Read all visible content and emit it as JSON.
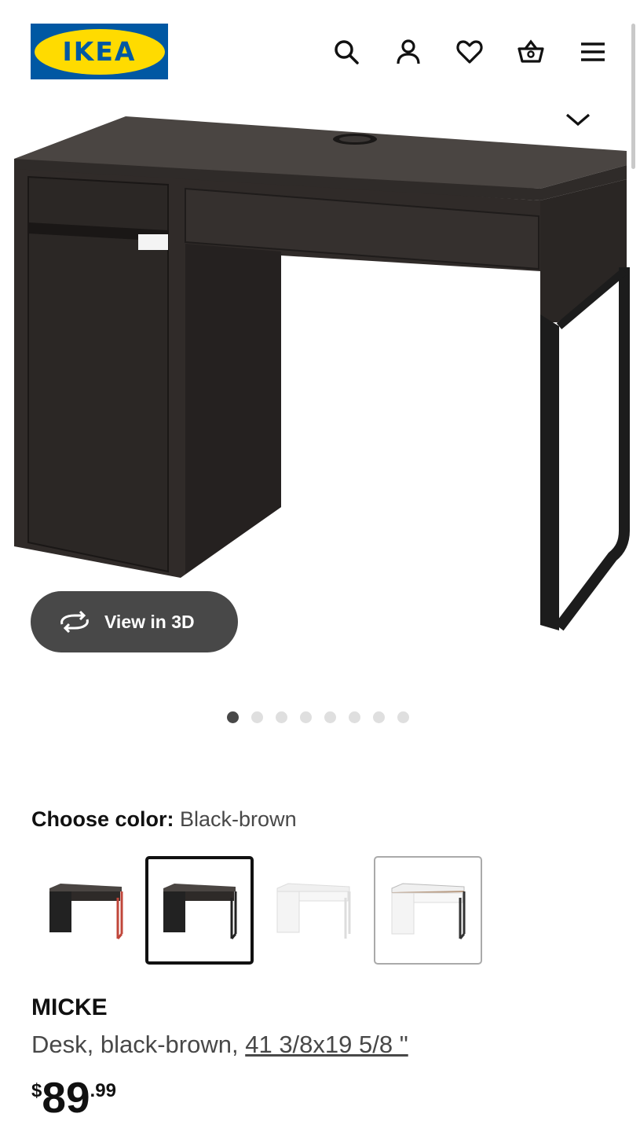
{
  "header": {
    "logo_text": "IKEA",
    "icons": [
      "search-icon",
      "account-icon",
      "heart-icon",
      "basket-icon",
      "menu-icon"
    ],
    "brand_blue": "#0058a3",
    "brand_yellow": "#ffdb00"
  },
  "gallery": {
    "view3d_label": "View in 3D",
    "image_count": 8,
    "active_index": 0
  },
  "color": {
    "label": "Choose color:",
    "value": "Black-brown",
    "options": [
      {
        "name": "black-brown-red",
        "selected": false
      },
      {
        "name": "black-brown",
        "selected": true
      },
      {
        "name": "white",
        "selected": false
      },
      {
        "name": "white-anthracite",
        "selected": false
      }
    ]
  },
  "product": {
    "name": "MICKE",
    "desc_prefix": "Desk, black-brown, ",
    "dimensions": "41 3/8x19 5/8 \"",
    "price_currency": "$",
    "price_integer": "89",
    "price_decimal": ".99"
  }
}
